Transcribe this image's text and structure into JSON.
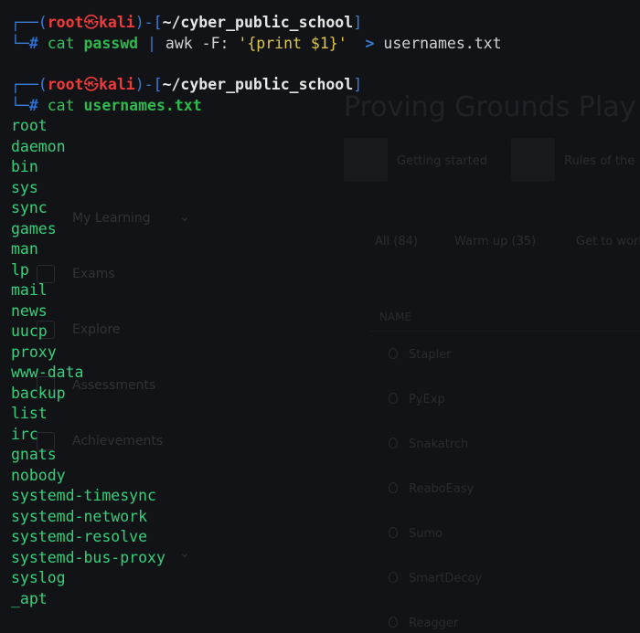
{
  "background_app": {
    "title": "Proving Grounds Play",
    "cards": [
      {
        "label": "Getting started"
      },
      {
        "label": "Rules of the"
      }
    ],
    "tabs": [
      "All (84)",
      "Warm up (35)",
      "Get to work"
    ],
    "table_header": "NAME",
    "rows": [
      "Stapler",
      "PyExp",
      "Snakatrch",
      "ReaboEasy",
      "Sumo",
      "SmartDecoy",
      "Reagger"
    ],
    "sidebar": [
      {
        "label": "My Learning"
      },
      {
        "label": "Exams"
      },
      {
        "label": "Explore"
      },
      {
        "label": "Assessments"
      },
      {
        "label": "Achievements"
      }
    ]
  },
  "terminal": {
    "prompt": {
      "user": "root",
      "host": "kali",
      "path": "~/cyber_public_school",
      "symbol": "#"
    },
    "commands": [
      {
        "cmd": "cat",
        "arg": "passwd",
        "pipe": "|",
        "cmd2": "awk",
        "opt": "-F:",
        "program": "'{print $1}'",
        "redirect": ">",
        "target": "usernames.txt"
      },
      {
        "cmd": "cat",
        "arg": "usernames.txt"
      }
    ],
    "output": [
      "root",
      "daemon",
      "bin",
      "sys",
      "sync",
      "games",
      "man",
      "lp",
      "mail",
      "news",
      "uucp",
      "proxy",
      "www-data",
      "backup",
      "list",
      "irc",
      "gnats",
      "nobody",
      "systemd-timesync",
      "systemd-network",
      "systemd-resolve",
      "systemd-bus-proxy",
      "syslog",
      "_apt"
    ]
  }
}
